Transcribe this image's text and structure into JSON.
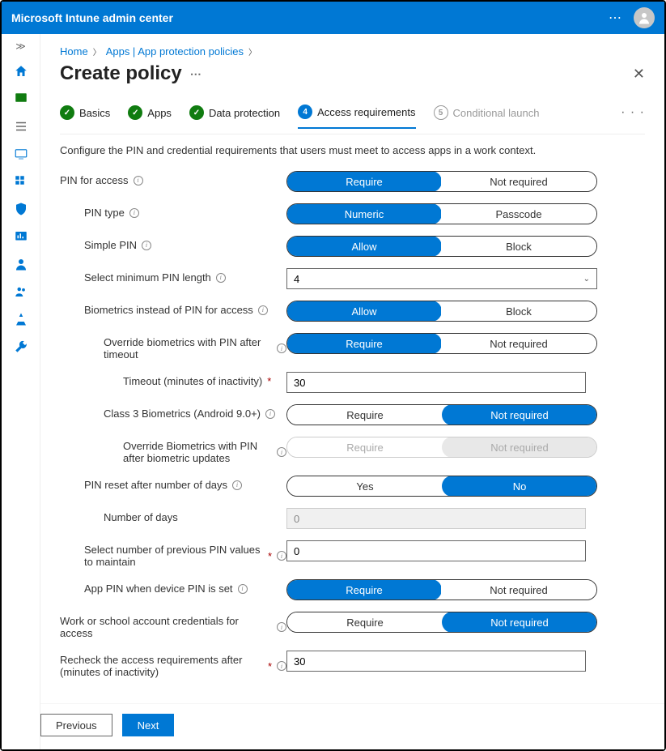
{
  "header": {
    "title": "Microsoft Intune admin center"
  },
  "breadcrumb": {
    "items": [
      "Home",
      "Apps | App protection policies"
    ]
  },
  "page": {
    "title": "Create policy"
  },
  "steps": {
    "items": [
      {
        "label": "Basics",
        "state": "done"
      },
      {
        "label": "Apps",
        "state": "done"
      },
      {
        "label": "Data protection",
        "state": "done"
      },
      {
        "label": "Access requirements",
        "state": "current",
        "num": "4"
      },
      {
        "label": "Conditional launch",
        "state": "pending",
        "num": "5"
      }
    ]
  },
  "intro": "Configure the PIN and credential requirements that users must meet to access apps in a work context.",
  "settings": {
    "pin_for_access": {
      "label": "PIN for access",
      "options": [
        "Require",
        "Not required"
      ],
      "value": "Require"
    },
    "pin_type": {
      "label": "PIN type",
      "options": [
        "Numeric",
        "Passcode"
      ],
      "value": "Numeric"
    },
    "simple_pin": {
      "label": "Simple PIN",
      "options": [
        "Allow",
        "Block"
      ],
      "value": "Allow"
    },
    "min_pin_length": {
      "label": "Select minimum PIN length",
      "value": "4"
    },
    "biometrics_instead": {
      "label": "Biometrics instead of PIN for access",
      "options": [
        "Allow",
        "Block"
      ],
      "value": "Allow"
    },
    "override_after_timeout": {
      "label": "Override biometrics with PIN after timeout",
      "options": [
        "Require",
        "Not required"
      ],
      "value": "Require"
    },
    "timeout_minutes": {
      "label": "Timeout (minutes of inactivity)",
      "value": "30"
    },
    "class3_biometrics": {
      "label": "Class 3 Biometrics (Android 9.0+)",
      "options": [
        "Require",
        "Not required"
      ],
      "value": "Not required"
    },
    "override_after_update": {
      "label": "Override Biometrics with PIN after biometric updates",
      "options": [
        "Require",
        "Not required"
      ],
      "value": "",
      "disabled": true
    },
    "pin_reset_days": {
      "label": "PIN reset after number of days",
      "options": [
        "Yes",
        "No"
      ],
      "value": "No"
    },
    "number_of_days": {
      "label": "Number of days",
      "value": "0",
      "disabled": true
    },
    "previous_pin_count": {
      "label": "Select number of previous PIN values to maintain",
      "value": "0"
    },
    "app_pin_when_device_pin": {
      "label": "App PIN when device PIN is set",
      "options": [
        "Require",
        "Not required"
      ],
      "value": "Require"
    },
    "work_account_creds": {
      "label": "Work or school account credentials for access",
      "options": [
        "Require",
        "Not required"
      ],
      "value": "Not required"
    },
    "recheck_after": {
      "label": "Recheck the access requirements after (minutes of inactivity)",
      "value": "30"
    }
  },
  "footer": {
    "previous": "Previous",
    "next": "Next"
  }
}
